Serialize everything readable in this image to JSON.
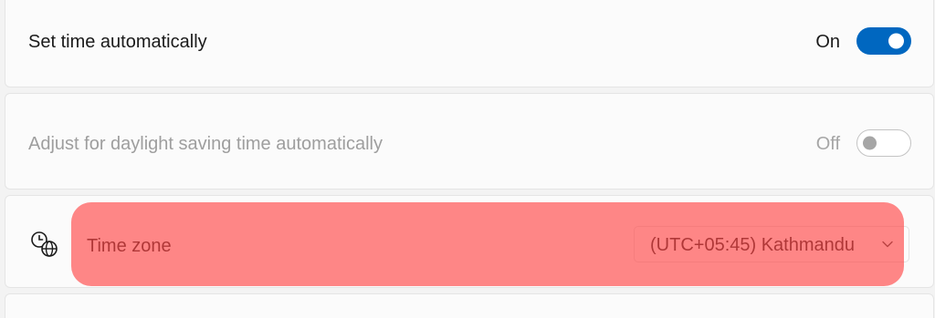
{
  "settings": {
    "auto_time": {
      "label": "Set time automatically",
      "state_label": "On",
      "enabled": true
    },
    "daylight_saving": {
      "label": "Adjust for daylight saving time automatically",
      "state_label": "Off",
      "enabled": false,
      "disabled": true
    },
    "time_zone": {
      "label": "Time zone",
      "icon": "clock-globe-icon",
      "selected": "(UTC+05:45) Kathmandu"
    }
  },
  "colors": {
    "accent": "#0067c0",
    "highlight": "#ff4646"
  }
}
